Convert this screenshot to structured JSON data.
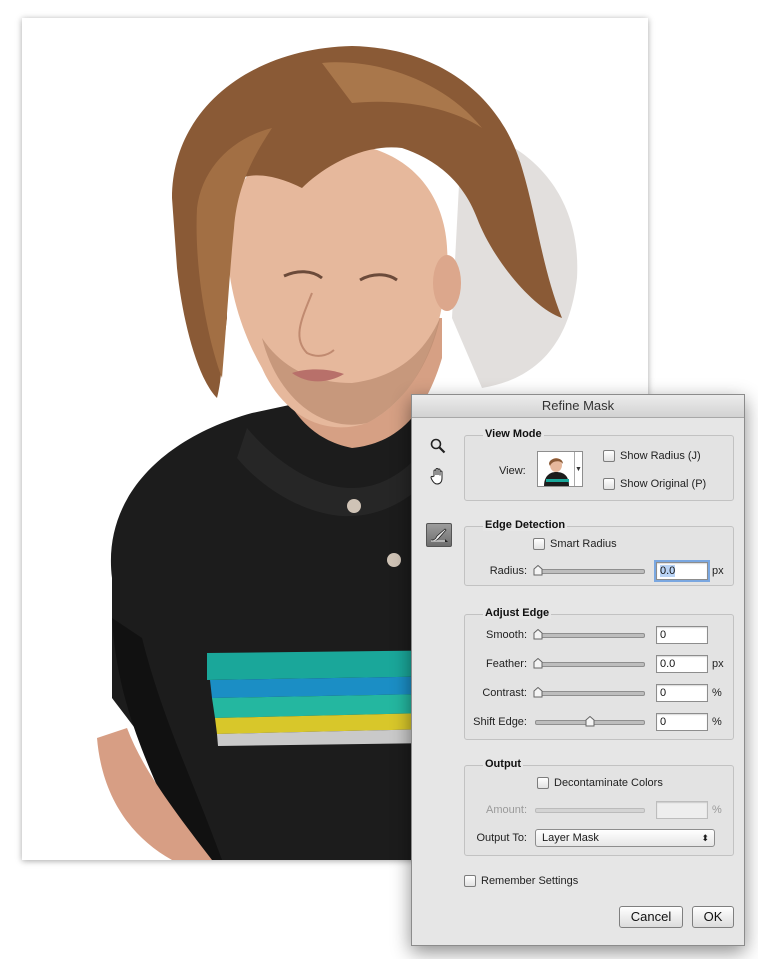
{
  "dialog": {
    "title": "Refine Mask",
    "tools": {
      "zoom_icon": "magnifier-icon",
      "hand_icon": "hand-icon",
      "brush_icon": "refine-radius-brush-icon"
    },
    "view_mode": {
      "legend": "View Mode",
      "view_label": "View:",
      "show_radius": {
        "label": "Show Radius (J)",
        "checked": false
      },
      "show_original": {
        "label": "Show Original (P)",
        "checked": false
      }
    },
    "edge_detection": {
      "legend": "Edge Detection",
      "smart_radius": {
        "label": "Smart Radius",
        "checked": false
      },
      "radius": {
        "label": "Radius:",
        "value": "0.0",
        "unit": "px",
        "slider_fraction": 0
      }
    },
    "adjust_edge": {
      "legend": "Adjust Edge",
      "smooth": {
        "label": "Smooth:",
        "value": "0",
        "unit": "",
        "slider_fraction": 0
      },
      "feather": {
        "label": "Feather:",
        "value": "0.0",
        "unit": "px",
        "slider_fraction": 0
      },
      "contrast": {
        "label": "Contrast:",
        "value": "0",
        "unit": "%",
        "slider_fraction": 0
      },
      "shift_edge": {
        "label": "Shift Edge:",
        "value": "0",
        "unit": "%",
        "slider_fraction": 0.5
      }
    },
    "output": {
      "legend": "Output",
      "decontaminate": {
        "label": "Decontaminate Colors",
        "checked": false
      },
      "amount": {
        "label": "Amount:",
        "value": "",
        "unit": "%",
        "enabled": false
      },
      "output_to": {
        "label": "Output To:",
        "selected": "Layer Mask"
      }
    },
    "remember": {
      "label": "Remember Settings",
      "checked": false
    },
    "buttons": {
      "cancel": "Cancel",
      "ok": "OK"
    }
  },
  "colors": {
    "dialog_bg": "#e6e6e6",
    "focus_ring": "#7aa7e0",
    "shirt": "#1c1c1c",
    "hair": "#8a5a36",
    "skin": "#e6b89c",
    "stripe_teal": "#1aa79a",
    "stripe_blue": "#1b8ec5",
    "stripe_yellow": "#d8c72a"
  }
}
